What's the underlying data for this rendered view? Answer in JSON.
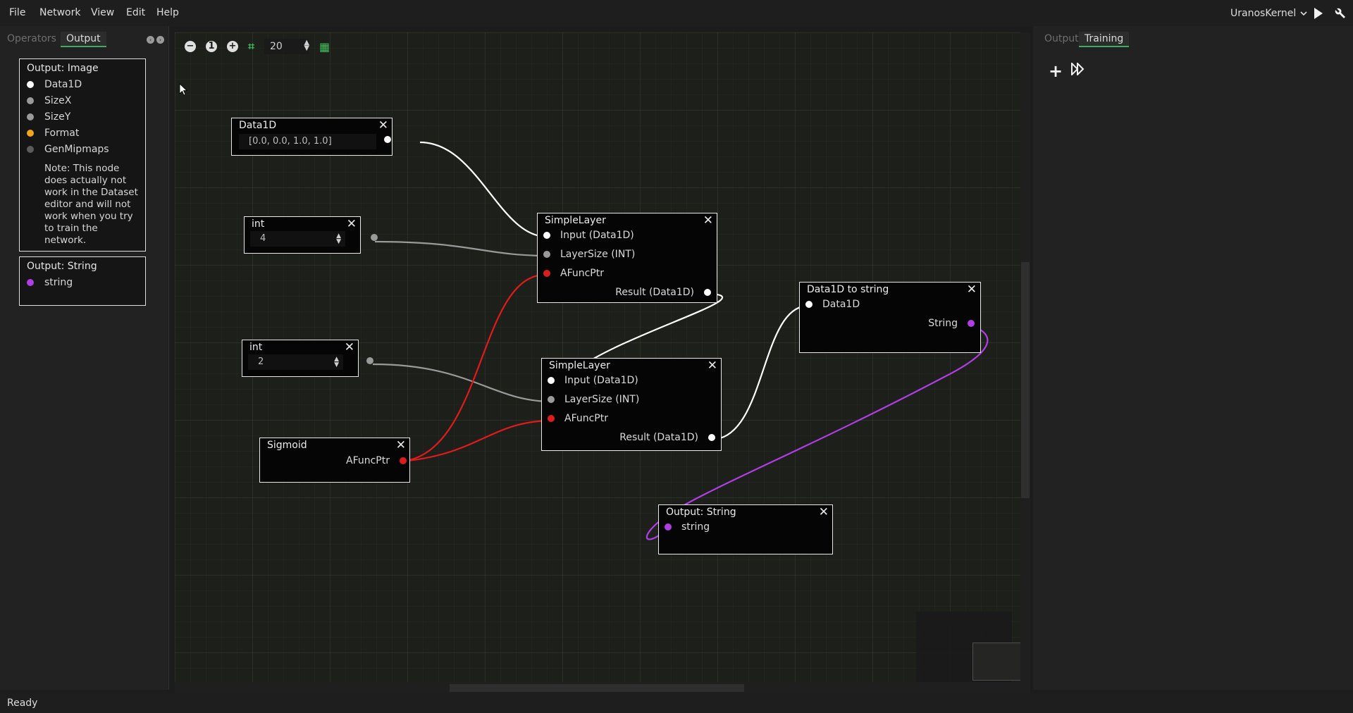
{
  "menubar": {
    "items": [
      "File",
      "Network",
      "View",
      "Edit",
      "Help"
    ],
    "kernel": "UranosKernel"
  },
  "left_panel": {
    "tabs": [
      "Operators",
      "Output"
    ],
    "active_tab": "Output",
    "output_image": {
      "title": "Output: Image",
      "ports": [
        {
          "label": "Data1D",
          "color": "#ffffff"
        },
        {
          "label": "SizeX",
          "color": "#9a9a9a"
        },
        {
          "label": "SizeY",
          "color": "#9a9a9a"
        },
        {
          "label": "Format",
          "color": "#f0a51c"
        },
        {
          "label": "GenMipmaps",
          "color": "#5c5c5c"
        }
      ],
      "note": "Note: This node does actually not work in the Dataset editor and will not work when you try to train the network."
    },
    "output_string": {
      "title": "Output: String",
      "ports": [
        {
          "label": "string",
          "color": "#b03ee6"
        }
      ]
    }
  },
  "canvas": {
    "grid_size": "20",
    "nodes": {
      "data1d": {
        "title": "Data1D",
        "value": "[0.0, 0.0, 1.0, 1.0]"
      },
      "int_a": {
        "title": "int",
        "value": "4"
      },
      "int_b": {
        "title": "int",
        "value": "2"
      },
      "sigmoid": {
        "title": "Sigmoid",
        "out": "AFuncPtr"
      },
      "layer1": {
        "title": "SimpleLayer",
        "in1": "Input (Data1D)",
        "in2": "LayerSize (INT)",
        "in3": "AFuncPtr",
        "out": "Result (Data1D)"
      },
      "layer2": {
        "title": "SimpleLayer",
        "in1": "Input (Data1D)",
        "in2": "LayerSize (INT)",
        "in3": "AFuncPtr",
        "out": "Result (Data1D)"
      },
      "to_string": {
        "title": "Data1D to string",
        "in1": "Data1D",
        "out": "String"
      },
      "out_string": {
        "title": "Output: String",
        "in1": "string"
      }
    },
    "colors": {
      "data": "#ffffff",
      "int": "#9a9a9a",
      "func": "#e01b1b",
      "string": "#b03ee6"
    }
  },
  "right_panel": {
    "tabs": [
      "Output",
      "Training"
    ],
    "active_tab": "Training"
  },
  "status": "Ready"
}
